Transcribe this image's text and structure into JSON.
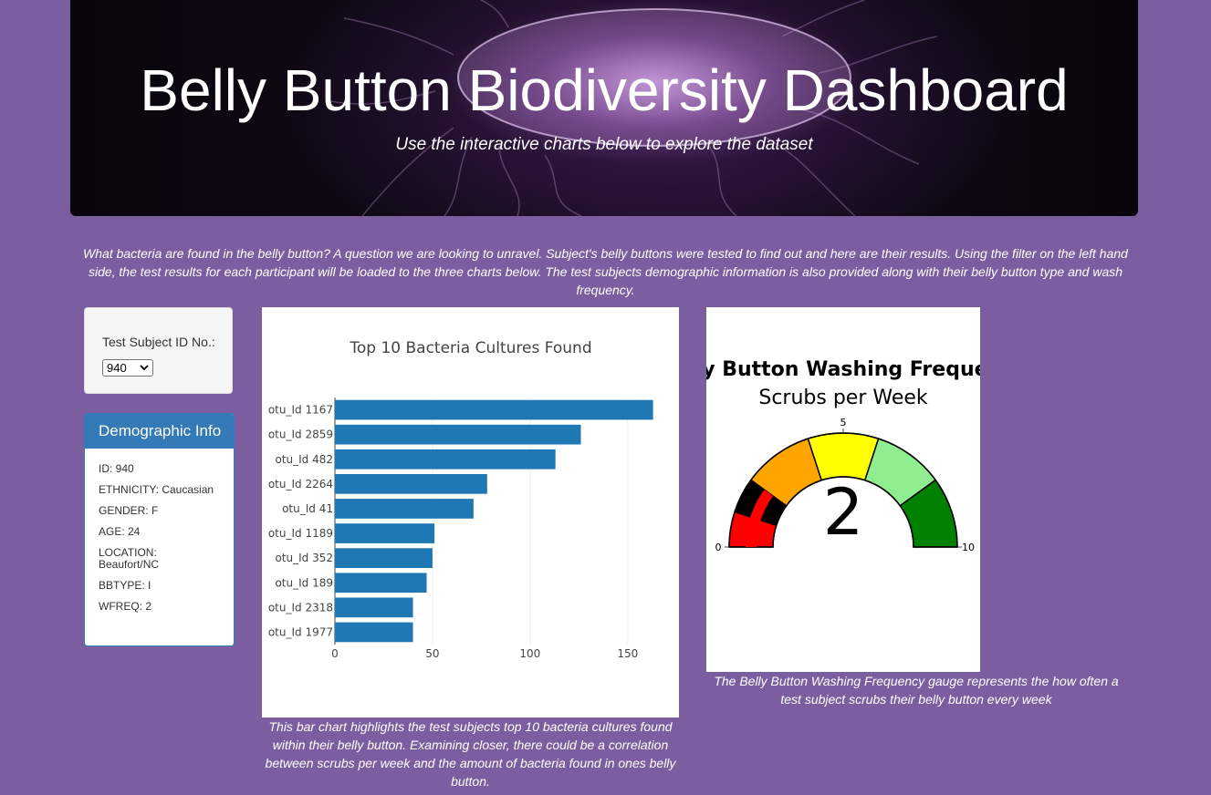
{
  "header": {
    "title": "Belly Button Biodiversity Dashboard",
    "subtitle": "Use the interactive charts below to explore the dataset"
  },
  "intro": "What bacteria are found in the belly button? A question we are looking to unravel. Subject's belly buttons were tested to find out and here are their results. Using the filter on the left hand side, the test results for each participant will be loaded to the three charts below. The test subjects demographic information is also provided along with their belly button type and wash frequency.",
  "selector": {
    "label": "Test Subject ID No.:",
    "value": "940"
  },
  "demographics": {
    "heading": "Demographic Info",
    "rows": [
      "ID: 940",
      "ETHNICITY: Caucasian",
      "GENDER: F",
      "AGE: 24",
      "LOCATION: Beaufort/NC",
      "BBTYPE: I",
      "WFREQ: 2"
    ]
  },
  "captions": {
    "bar": "This bar chart highlights the test subjects top 10 bacteria cultures found within their belly button. Examining closer, there could be a correlation between scrubs per week and the amount of bacteria found in ones belly button.",
    "gauge": "The Belly Button Washing Frequency gauge represents the how often a test subject scrubs their belly button every week"
  },
  "colors": {
    "background": "#7b5ea0",
    "bar": "#1f77b4",
    "panel_header": "#337ab7"
  },
  "chart_data": [
    {
      "type": "bar",
      "orientation": "horizontal",
      "title": "Top 10 Bacteria Cultures Found",
      "categories": [
        "otu_Id 1167",
        "otu_Id 2859",
        "otu_Id 482",
        "otu_Id 2264",
        "otu_Id 41",
        "otu_Id 1189",
        "otu_Id 352",
        "otu_Id 189",
        "otu_Id 2318",
        "otu_Id 1977"
      ],
      "values": [
        163,
        126,
        113,
        78,
        71,
        51,
        50,
        47,
        40,
        40
      ],
      "xticks": [
        0,
        50,
        100,
        150
      ],
      "xlim": [
        0,
        171.6
      ],
      "grid": true
    },
    {
      "type": "gauge",
      "title": "Belly Button Washing Frequency",
      "subtitle": "Scrubs per Week",
      "value": 2,
      "range": [
        0,
        10
      ],
      "tick_labels": [
        "0",
        "5",
        "10"
      ],
      "steps": [
        {
          "range": [
            0,
            1
          ],
          "color": "red"
        },
        {
          "range": [
            1,
            2
          ],
          "color": "black"
        },
        {
          "range": [
            2,
            4
          ],
          "color": "orange"
        },
        {
          "range": [
            4,
            6
          ],
          "color": "yellow"
        },
        {
          "range": [
            6,
            8
          ],
          "color": "lightgreen"
        },
        {
          "range": [
            8,
            10
          ],
          "color": "green"
        }
      ],
      "bar_color": "red"
    }
  ]
}
